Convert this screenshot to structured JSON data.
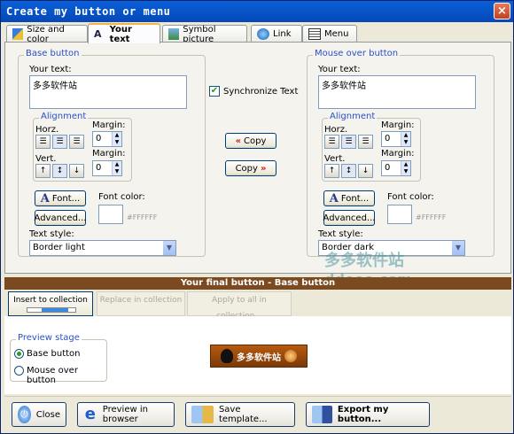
{
  "window": {
    "title": "Create my button or menu",
    "close": "×"
  },
  "tabs": [
    {
      "label": "Size and color",
      "icon": "size-color-icon"
    },
    {
      "label": "Your text",
      "icon": "text-icon"
    },
    {
      "label": "Symbol picture",
      "icon": "picture-icon"
    },
    {
      "label": "Link",
      "icon": "globe-link-icon"
    },
    {
      "label": "Menu",
      "icon": "menu-icon"
    }
  ],
  "base": {
    "group": "Base button",
    "your_text_label": "Your text:",
    "text": "多多软件站",
    "alignment": "Alignment",
    "horz": "Horz.",
    "vert": "Vert.",
    "margin_label": "Margin:",
    "margin_h": "0",
    "margin_v": "0",
    "font_button": "Font...",
    "advanced_button": "Advanced...",
    "font_color_label": "Font color:",
    "font_color": "#FFFFFF",
    "text_style_label": "Text style:",
    "text_style": "Border light"
  },
  "middle": {
    "sync": "Synchronize Text",
    "copy_left": "Copy",
    "copy_right": "Copy"
  },
  "over": {
    "group": "Mouse over button",
    "your_text_label": "Your text:",
    "text": "多多软件站",
    "alignment": "Alignment",
    "horz": "Horz.",
    "vert": "Vert.",
    "margin_label": "Margin:",
    "margin_h": "0",
    "margin_v": "0",
    "font_button": "Font...",
    "advanced_button": "Advanced...",
    "font_color_label": "Font color:",
    "font_color": "#FFFFFF",
    "text_style_label": "Text style:",
    "text_style": "Border dark"
  },
  "final": {
    "title": "Your final button - Base button",
    "insert": "Insert to collection",
    "replace": "Replace in collection",
    "apply": "Apply to all in collection..."
  },
  "preview": {
    "group": "Preview stage",
    "base": "Base button",
    "over": "Mouse over button",
    "button_text": "多多软件站"
  },
  "bottom": {
    "close": "Close",
    "browser": "Preview in browser",
    "save": "Save template...",
    "export": "Export my button..."
  },
  "watermark": {
    "line1": "多多软件站",
    "line2": "ddooo.com"
  },
  "colors": {
    "accent": "#2a50c8",
    "final_bar": "#7b4a20",
    "swatch": "#FFFFFF"
  }
}
